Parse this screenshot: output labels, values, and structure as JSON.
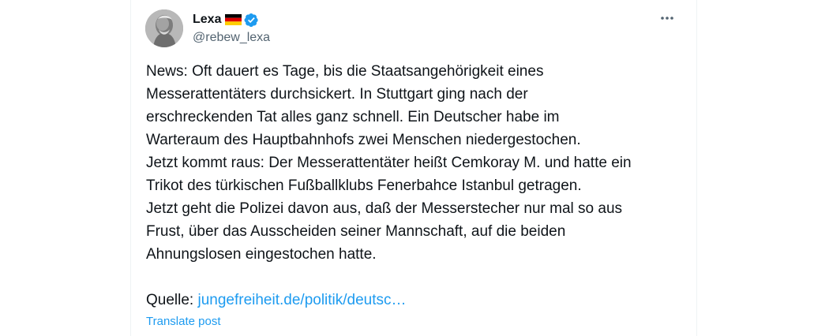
{
  "author": {
    "display_name": "Lexa",
    "handle": "@rebew_lexa",
    "flag_icon": "germany-flag-icon",
    "verified_icon": "verified-badge-icon",
    "verified_color": "#1d9bf0"
  },
  "post": {
    "text": "News: Oft dauert es Tage, bis die Staatsangehörigkeit eines\nMesserattentäters durchsickert. In Stuttgart ging nach der\nerschreckenden Tat alles ganz schnell. Ein Deutscher habe im\nWarteraum des Hauptbahnhofs zwei Menschen niedergestochen.\nJetzt kommt raus: Der Messerattentäter heißt Cemkoray M. und hatte ein\nTrikot des türkischen Fußballklubs Fenerbahce Istanbul getragen.\nJetzt geht die Polizei davon aus, daß der Messerstecher nur mal so aus\nFrust, über das Ausscheiden seiner Mannschaft, auf die beiden\nAhnungslosen eingestochen hatte.",
    "source_label": "Quelle:",
    "source_link": "jungefreiheit.de/politik/deutsc…",
    "translate_label": "Translate post"
  },
  "icons": {
    "more": "more-options-icon"
  },
  "colors": {
    "link": "#1d9bf0",
    "text": "#0f1419",
    "secondary": "#536471"
  }
}
